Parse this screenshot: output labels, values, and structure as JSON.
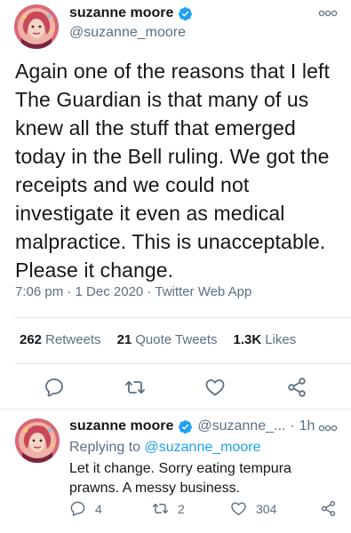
{
  "main_tweet": {
    "author_name": "suzanne moore",
    "author_handle": "@suzanne_moore",
    "text": "Again one of the reasons that I left The Guardian is that many of us knew all the stuff that emerged today in the Bell ruling. We got the receipts and we could not investigate it even as medical malpractice. This is unacceptable. Please it change.",
    "time": "7:06 pm",
    "date": "1 Dec 2020",
    "source": "Twitter Web App",
    "separator": "·",
    "stats": {
      "retweets_count": "262",
      "retweets_label": "Retweets",
      "quote_count": "21",
      "quote_label": "Quote Tweets",
      "likes_count": "1.3K",
      "likes_label": "Likes"
    },
    "icons": {
      "verified": "verified-badge-icon",
      "more": "more-options-icon",
      "reply": "reply-icon",
      "retweet": "retweet-icon",
      "like": "like-icon",
      "share": "share-icon"
    }
  },
  "reply_tweet": {
    "author_name": "suzanne moore",
    "author_handle": "@suzanne_...",
    "separator": "·",
    "age": "1h",
    "replying_prefix": "Replying to",
    "replying_handle": "@suzanne_moore",
    "text": "Let it change. Sorry eating tempura prawns. A messy business.",
    "reply_count": "4",
    "retweet_count": "2",
    "like_count": "304"
  },
  "colors": {
    "text_primary": "#14171a",
    "text_secondary": "#5b7083",
    "accent_blue": "#1da1f2",
    "divider": "#e1e8ed"
  }
}
